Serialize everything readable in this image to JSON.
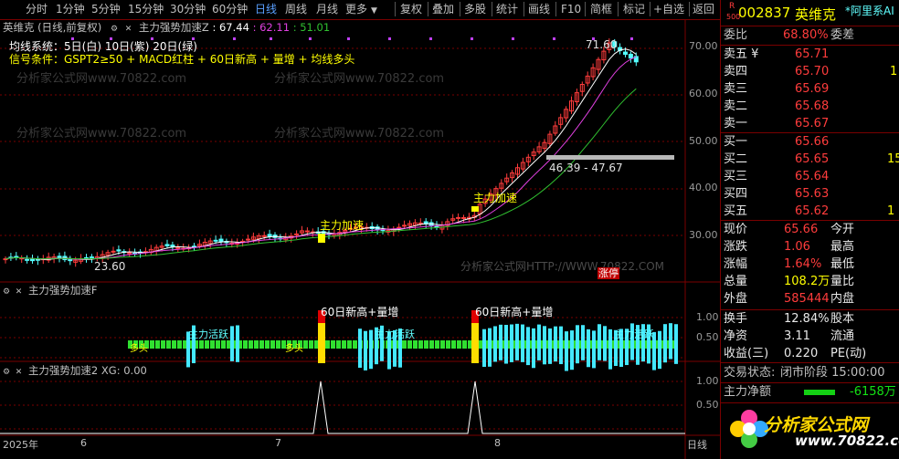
{
  "toolbar": {
    "left": [
      "分时",
      "1分钟",
      "5分钟",
      "15分钟",
      "30分钟",
      "60分钟",
      "日线",
      "周线",
      "月线",
      "更多"
    ],
    "right": [
      "复权",
      "叠加",
      "多股",
      "统计",
      "画线",
      "F10",
      "简框",
      "标记",
      "+自选",
      "返回"
    ],
    "active": "日线"
  },
  "main_pane": {
    "title": "英维克 (日线,前复权)",
    "indicator_name": "主力强势加速Z",
    "indicator_values": [
      "67.44",
      "62.11",
      "51.01"
    ],
    "ma_text": "均线系统：5日(白)  10日(紫)  20日(绿)",
    "signal_text": "信号条件：GSPT2≥50 + MACD红柱 + 60日新高 + 量增 + 均线多头",
    "y_ticks": [
      "70.00",
      "60.00",
      "50.00",
      "40.00",
      "30.00"
    ],
    "high_label": "71.60",
    "low_label": "23.60",
    "range_label": "46.39 - 47.67",
    "accel_labels": [
      "主力加速",
      "主力加速"
    ],
    "watermark": "分析家公式网www.70822.com",
    "watermark2": "分析家公式网HTTP://WWW.70822.COM",
    "zhangting": "涨停"
  },
  "pane2": {
    "title": "主力强势加速F",
    "y_ticks": [
      "1.00",
      "0.50"
    ],
    "labels": [
      "60日新高+量增",
      "60日新高+量增"
    ],
    "sub_labels": [
      "主力活跃",
      "主力活跃",
      "主力活跃"
    ],
    "sub_labels2": [
      "多头",
      "多头"
    ]
  },
  "pane3": {
    "title": "主力强势加速2  XG: 0.00",
    "y_ticks": [
      "1.00",
      "0.50"
    ]
  },
  "xaxis": {
    "labels": [
      "2025年",
      "6",
      "7",
      "8"
    ],
    "period": "日线"
  },
  "quote": {
    "code": "002837",
    "name": "英维克",
    "badge_top": "R",
    "badge_bottom": "500",
    "tag": "*阿里系AI",
    "weibi_label": "委比",
    "weibi": "68.80%",
    "weicha_label": "委差",
    "sell": [
      {
        "label": "卖五 ¥",
        "price": "65.71",
        "vol": ""
      },
      {
        "label": "卖四",
        "price": "65.70",
        "vol": "1"
      },
      {
        "label": "卖三",
        "price": "65.69",
        "vol": ""
      },
      {
        "label": "卖二",
        "price": "65.68",
        "vol": ""
      },
      {
        "label": "卖一",
        "price": "65.67",
        "vol": ""
      }
    ],
    "buy": [
      {
        "label": "买一",
        "price": "65.66",
        "vol": ""
      },
      {
        "label": "买二",
        "price": "65.65",
        "vol": "15"
      },
      {
        "label": "买三",
        "price": "65.64",
        "vol": ""
      },
      {
        "label": "买四",
        "price": "65.63",
        "vol": ""
      },
      {
        "label": "买五",
        "price": "65.62",
        "vol": "1"
      }
    ],
    "stats": [
      {
        "l1": "现价",
        "v1": "65.66",
        "l2": "今开",
        "c": "red"
      },
      {
        "l1": "涨跌",
        "v1": "1.06",
        "l2": "最高",
        "c": "red"
      },
      {
        "l1": "涨幅",
        "v1": "1.64%",
        "l2": "最低",
        "c": "red"
      },
      {
        "l1": "总量",
        "v1": "108.2万",
        "l2": "量比",
        "c": "yellow"
      },
      {
        "l1": "外盘",
        "v1": "585444",
        "l2": "内盘",
        "c": "red"
      }
    ],
    "stats2": [
      {
        "l1": "换手",
        "v1": "12.84%",
        "l2": "股本"
      },
      {
        "l1": "净资",
        "v1": "3.11",
        "l2": "流通"
      },
      {
        "l1": "收益(三)",
        "v1": "0.220",
        "l2": "PE(动)"
      }
    ],
    "trade_status_label": "交易状态:",
    "trade_status": "闭市阶段 15:00:00",
    "net_label": "主力净额",
    "net_value": "-6158万",
    "logo_text": "分析家公式网",
    "logo_url": "www.70822.com"
  },
  "colors": {
    "up": "#ff3c3c",
    "down": "#54ffff",
    "ma5": "#ffffff",
    "ma10": "#e040e0",
    "ma20": "#30c030",
    "grid": "#7a0000"
  }
}
